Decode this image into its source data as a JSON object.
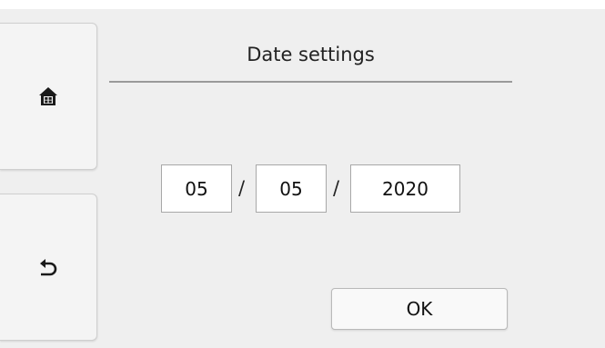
{
  "header": {
    "title": "Date settings"
  },
  "nav": {
    "home": {
      "icon": "home-icon"
    },
    "back": {
      "icon": "back-arrow-icon"
    }
  },
  "date": {
    "month": "05",
    "day": "05",
    "year": "2020",
    "separator": "/"
  },
  "actions": {
    "ok_label": "OK"
  }
}
